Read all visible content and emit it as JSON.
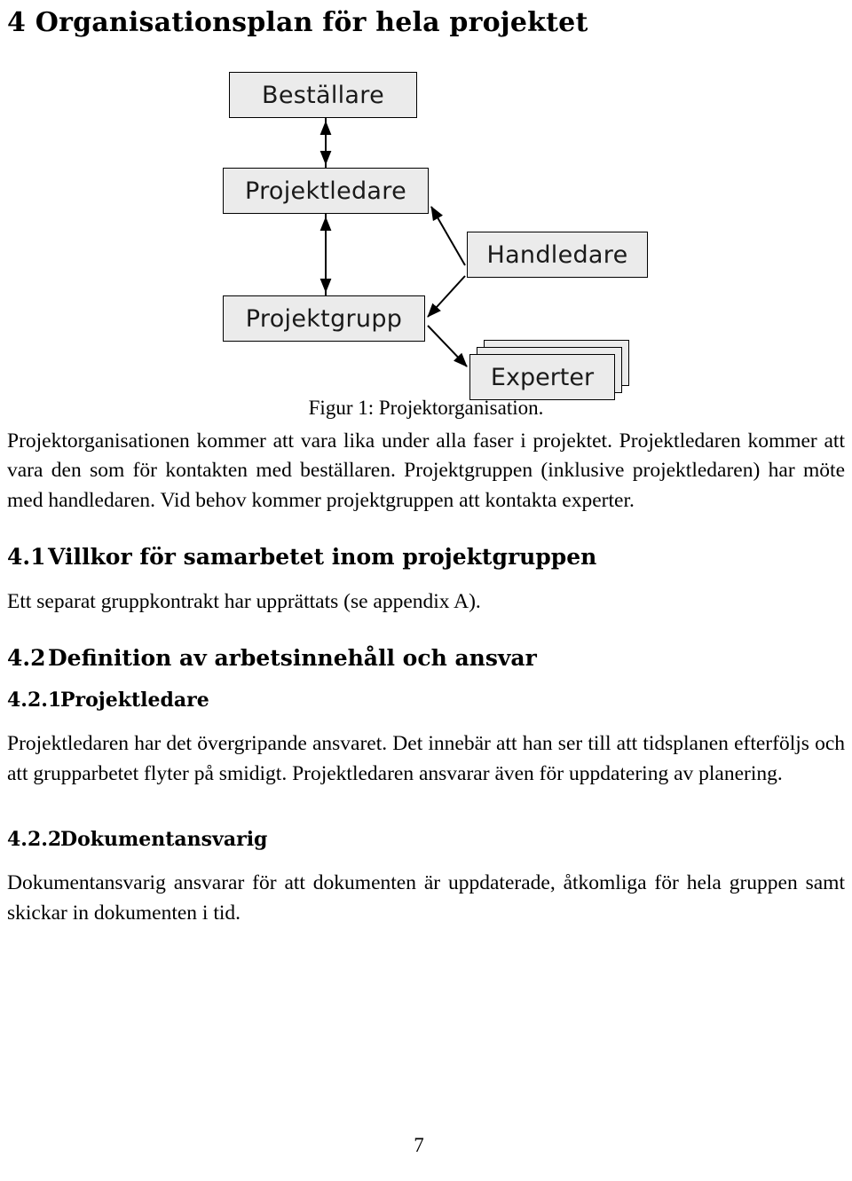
{
  "document": {
    "page_number": "7",
    "section": {
      "number": "4",
      "title": "Organisationsplan för hela projektet"
    },
    "figure": {
      "caption": "Figur 1: Projektorganisation.",
      "nodes": {
        "bestallare": "Beställare",
        "projektledare": "Projektledare",
        "handledare": "Handledare",
        "projektgrupp": "Projektgrupp",
        "experter": "Experter"
      }
    },
    "intro_paragraph": "Projektorganisationen kommer att vara lika under alla faser i projektet. Projektledaren kommer att vara den som för kontakten med beställaren. Projektgruppen (inklusive projektledaren) har möte med handledaren. Vid behov kommer projektgruppen att kontakta experter.",
    "subsections": [
      {
        "number": "4.1",
        "title": "Villkor för samarbetet inom projektgruppen",
        "body": "Ett separat gruppkontrakt har upprättats (se appendix A)."
      },
      {
        "number": "4.2",
        "title": "Definition av arbetsinnehåll och ansvar"
      }
    ],
    "subsubsections": [
      {
        "number": "4.2.1",
        "title": "Projektledare",
        "body": "Projektledaren har det övergripande ansvaret. Det innebär att han ser till att tidsplanen efterföljs och att grupparbetet flyter på smidigt. Projektledaren ansvarar även för uppdatering av planering."
      },
      {
        "number": "4.2.2",
        "title": "Dokumentansvarig",
        "body": "Dokumentansvarig ansvarar för att dokumenten är uppdaterade, åtkomliga för hela gruppen samt skickar in dokumenten i tid."
      }
    ]
  }
}
